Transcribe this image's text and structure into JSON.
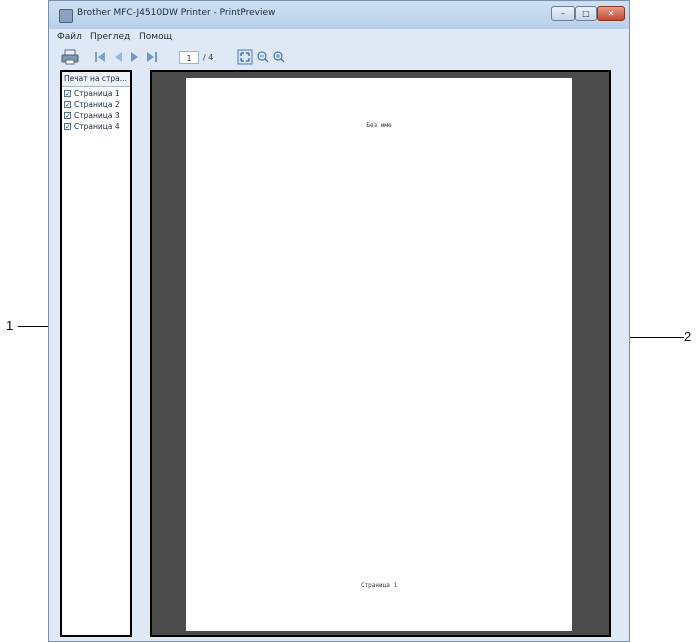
{
  "window": {
    "title": "Brother MFC-J4510DW Printer - PrintPreview",
    "controls": {
      "minimize": "–",
      "maximize": "□",
      "close": "✕"
    }
  },
  "menu": [
    {
      "label": "Файл"
    },
    {
      "label": "Преглед"
    },
    {
      "label": "Помощ"
    }
  ],
  "toolbar": {
    "current_page": "1",
    "total_pages": "/ 4",
    "icons": [
      "print-icon",
      "first-page-icon",
      "prev-page-icon",
      "next-page-icon",
      "last-page-icon",
      "fit-page-icon",
      "zoom-out-icon",
      "zoom-in-icon"
    ]
  },
  "left_pane": {
    "header": "Печат на стра...",
    "pages": [
      {
        "label": "Страница 1",
        "checked": true
      },
      {
        "label": "Страница 2",
        "checked": true
      },
      {
        "label": "Страница 3",
        "checked": true
      },
      {
        "label": "Страница 4",
        "checked": true
      }
    ]
  },
  "preview": {
    "sheet_title": "Без име",
    "sheet_footer": "Страница 1"
  },
  "callouts": {
    "left": "1",
    "right": "2"
  },
  "colors": {
    "preview_background": "#4b4b4b",
    "frame": "#000000",
    "window_chrome": "#dfe9f5"
  }
}
